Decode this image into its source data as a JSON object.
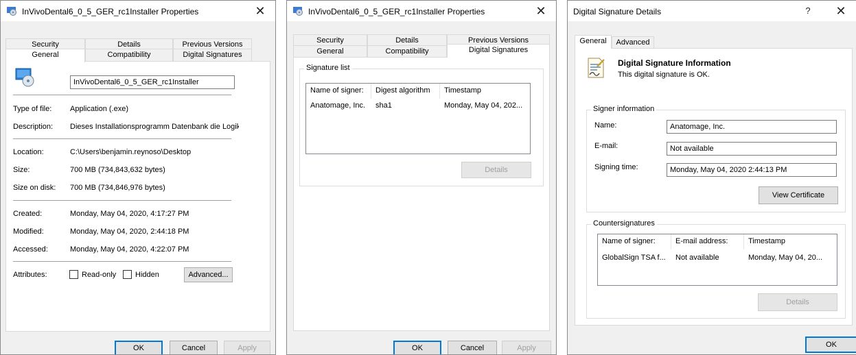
{
  "window1": {
    "title": "InVivoDental6_0_5_GER_rc1Installer Properties",
    "close_glyph": "✕",
    "tabs_row1": [
      "Security",
      "Details",
      "Previous Versions"
    ],
    "tabs_row2": [
      "General",
      "Compatibility",
      "Digital Signatures"
    ],
    "active_tab": "General",
    "file_name": "InVivoDental6_0_5_GER_rc1Installer",
    "props": [
      {
        "label": "Type of file:",
        "value": "Application (.exe)"
      },
      {
        "label": "Description:",
        "value": "Dieses Installationsprogramm Datenbank die Logik u"
      },
      {
        "label": "Location:",
        "value": "C:\\Users\\benjamin.reynoso\\Desktop"
      },
      {
        "label": "Size:",
        "value": "700 MB (734,843,632 bytes)"
      },
      {
        "label": "Size on disk:",
        "value": "700 MB (734,846,976 bytes)"
      },
      {
        "label": "Created:",
        "value": "Monday, May 04, 2020, 4:17:27 PM"
      },
      {
        "label": "Modified:",
        "value": "Monday, May 04, 2020, 2:44:18 PM"
      },
      {
        "label": "Accessed:",
        "value": "Monday, May 04, 2020, 4:22:07 PM"
      }
    ],
    "attributes_label": "Attributes:",
    "readonly_label": "Read-only",
    "hidden_label": "Hidden",
    "advanced_label": "Advanced...",
    "ok": "OK",
    "cancel": "Cancel",
    "apply": "Apply"
  },
  "window2": {
    "title": "InVivoDental6_0_5_GER_rc1Installer Properties",
    "close_glyph": "✕",
    "tabs_row1": [
      "Security",
      "Details",
      "Previous Versions"
    ],
    "tabs_row2": [
      "General",
      "Compatibility",
      "Digital Signatures"
    ],
    "active_tab": "Digital Signatures",
    "signature_list_label": "Signature list",
    "columns": [
      "Name of signer:",
      "Digest algorithm",
      "Timestamp"
    ],
    "rows": [
      [
        "Anatomage, Inc.",
        "sha1",
        "Monday, May 04, 202..."
      ]
    ],
    "details": "Details",
    "ok": "OK",
    "cancel": "Cancel",
    "apply": "Apply"
  },
  "window3": {
    "title": "Digital Signature Details",
    "help_glyph": "?",
    "close_glyph": "✕",
    "tabs": [
      "General",
      "Advanced"
    ],
    "active_tab": "General",
    "heading": "Digital Signature Information",
    "status": "This digital signature is OK.",
    "signer_info_label": "Signer information",
    "name_label": "Name:",
    "name_value": "Anatomage, Inc.",
    "email_label": "E-mail:",
    "email_value": "Not available",
    "signing_time_label": "Signing time:",
    "signing_time_value": "Monday, May 04, 2020 2:44:13 PM",
    "view_certificate": "View Certificate",
    "countersignatures_label": "Countersignatures",
    "columns": [
      "Name of signer:",
      "E-mail address:",
      "Timestamp"
    ],
    "rows": [
      [
        "GlobalSign TSA f...",
        "Not available",
        "Monday, May 04, 20..."
      ]
    ],
    "details": "Details",
    "ok": "OK"
  }
}
